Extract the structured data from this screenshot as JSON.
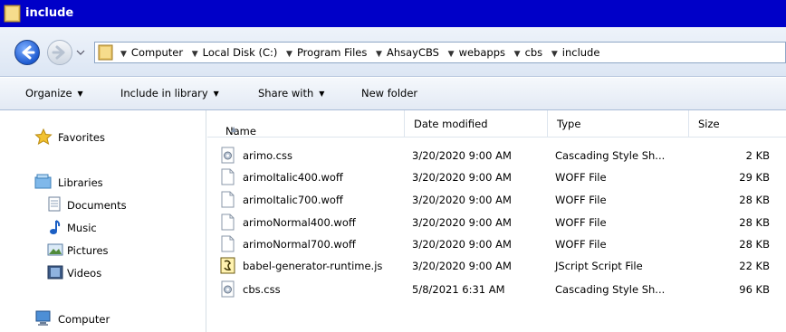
{
  "window": {
    "title": "include"
  },
  "address": {
    "crumbs": [
      "Computer",
      "Local Disk (C:)",
      "Program Files",
      "AhsayCBS",
      "webapps",
      "cbs",
      "include"
    ]
  },
  "toolbar": {
    "organize": "Organize",
    "include_in_library": "Include in library",
    "share_with": "Share with",
    "new_folder": "New folder"
  },
  "nav": {
    "favorites": "Favorites",
    "libraries": "Libraries",
    "documents": "Documents",
    "music": "Music",
    "pictures": "Pictures",
    "videos": "Videos",
    "computer": "Computer"
  },
  "columns": {
    "name": "Name",
    "date": "Date modified",
    "type": "Type",
    "size": "Size"
  },
  "files": [
    {
      "name": "arimo.css",
      "date": "3/20/2020 9:00 AM",
      "type": "Cascading Style Sh...",
      "size": "2 KB",
      "icon": "css-file-icon"
    },
    {
      "name": "arimoItalic400.woff",
      "date": "3/20/2020 9:00 AM",
      "type": "WOFF File",
      "size": "29 KB",
      "icon": "blank-file-icon"
    },
    {
      "name": "arimoItalic700.woff",
      "date": "3/20/2020 9:00 AM",
      "type": "WOFF File",
      "size": "28 KB",
      "icon": "blank-file-icon"
    },
    {
      "name": "arimoNormal400.woff",
      "date": "3/20/2020 9:00 AM",
      "type": "WOFF File",
      "size": "28 KB",
      "icon": "blank-file-icon"
    },
    {
      "name": "arimoNormal700.woff",
      "date": "3/20/2020 9:00 AM",
      "type": "WOFF File",
      "size": "28 KB",
      "icon": "blank-file-icon"
    },
    {
      "name": "babel-generator-runtime.js",
      "date": "3/20/2020 9:00 AM",
      "type": "JScript Script File",
      "size": "22 KB",
      "icon": "script-file-icon"
    },
    {
      "name": "cbs.css",
      "date": "5/8/2021 6:31 AM",
      "type": "Cascading Style Sh...",
      "size": "96 KB",
      "icon": "css-file-icon"
    }
  ]
}
